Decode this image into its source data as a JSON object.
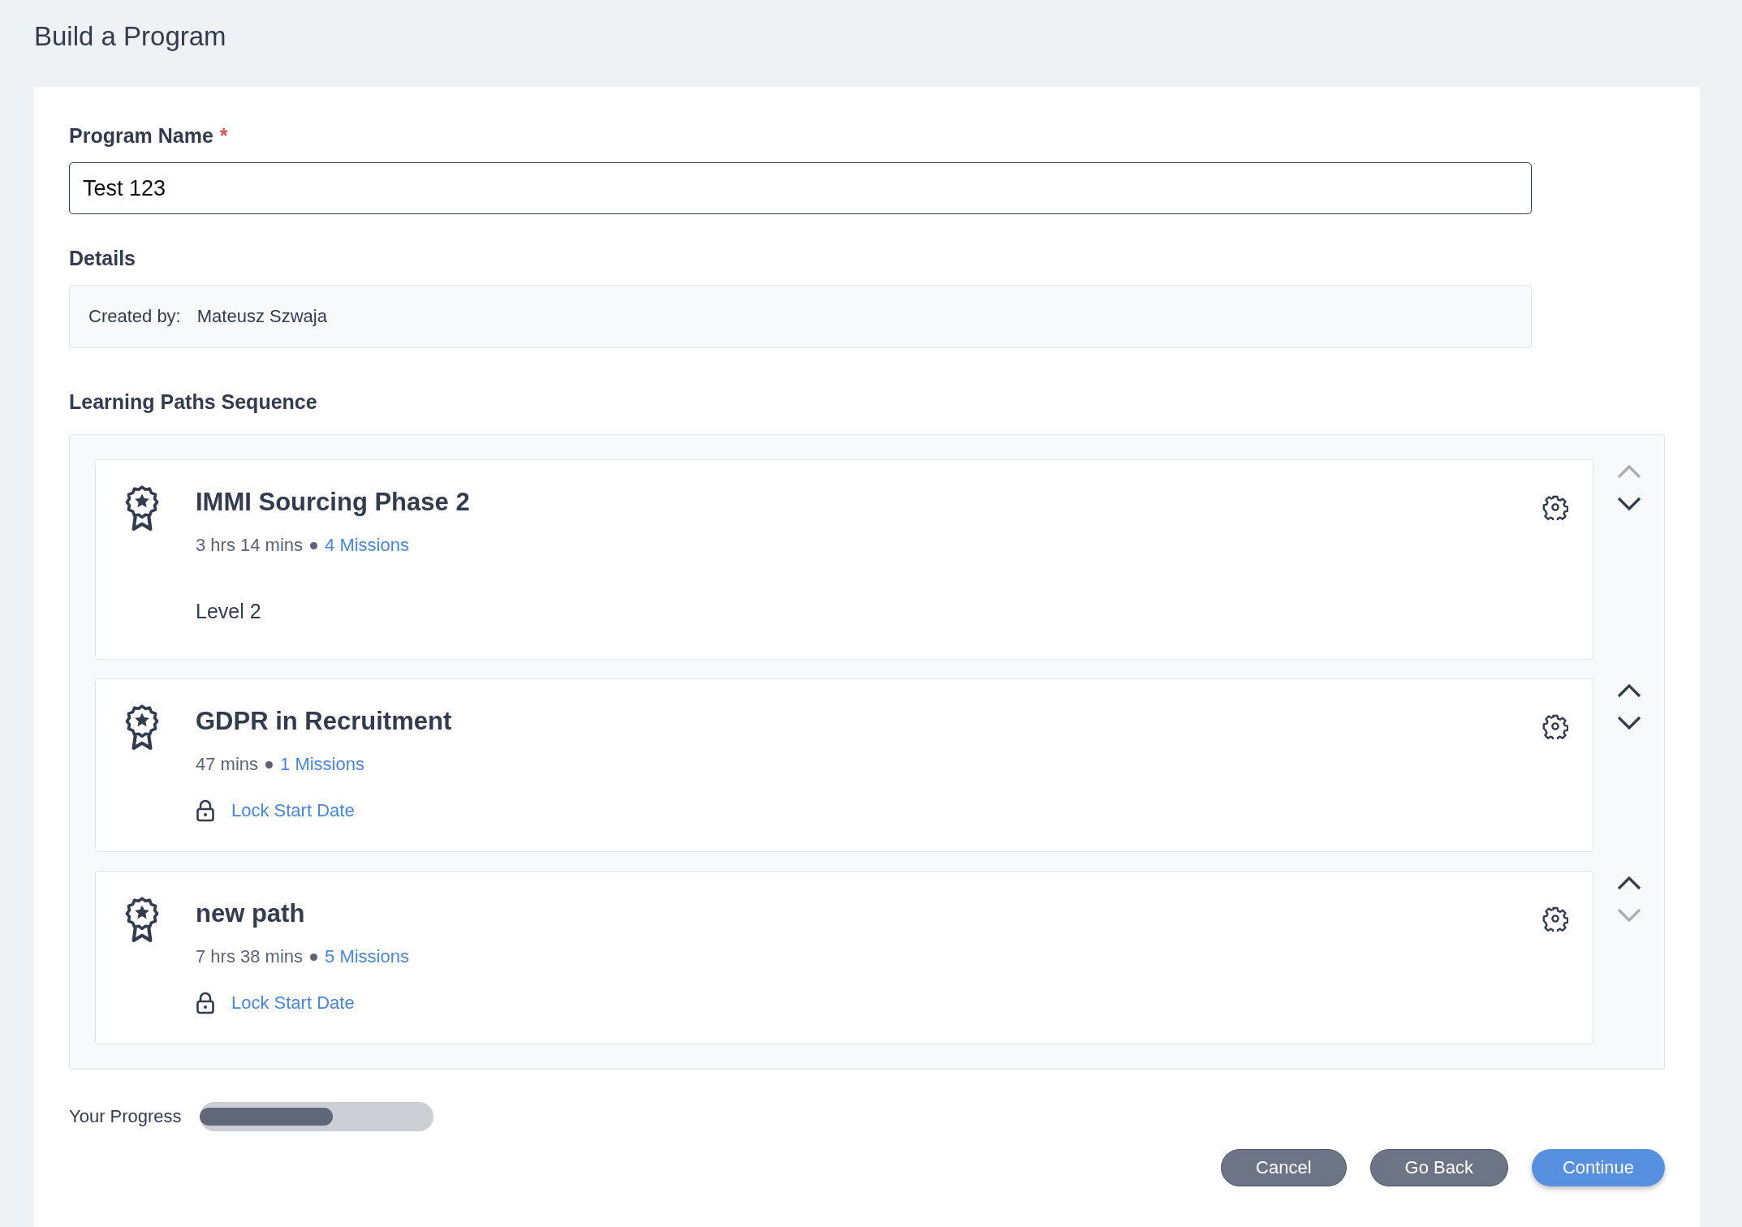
{
  "page_title": "Build a Program",
  "program_name": {
    "label": "Program Name",
    "required_mark": "*",
    "value": "Test 123"
  },
  "details": {
    "label": "Details",
    "created_by_label": "Created by:",
    "created_by_value": "Mateusz Szwaja"
  },
  "sequence": {
    "label": "Learning Paths Sequence",
    "paths": [
      {
        "title": "IMMI Sourcing Phase 2",
        "duration": "3 hrs 14 mins",
        "missions": "4 Missions",
        "note": "Level 2",
        "up_disabled": true,
        "down_disabled": false
      },
      {
        "title": "GDPR in Recruitment",
        "duration": "47 mins",
        "missions": "1 Missions",
        "lock_label": "Lock Start Date",
        "up_disabled": false,
        "down_disabled": false
      },
      {
        "title": "new path",
        "duration": "7 hrs 38 mins",
        "missions": "5 Missions",
        "lock_label": "Lock Start Date",
        "up_disabled": false,
        "down_disabled": true
      }
    ]
  },
  "progress": {
    "label": "Your Progress",
    "level": 0.57
  },
  "buttons": [
    {
      "label": "Cancel",
      "kind": "secondary"
    },
    {
      "label": "Go Back",
      "kind": "secondary"
    },
    {
      "label": "Continue",
      "kind": "primary"
    }
  ]
}
